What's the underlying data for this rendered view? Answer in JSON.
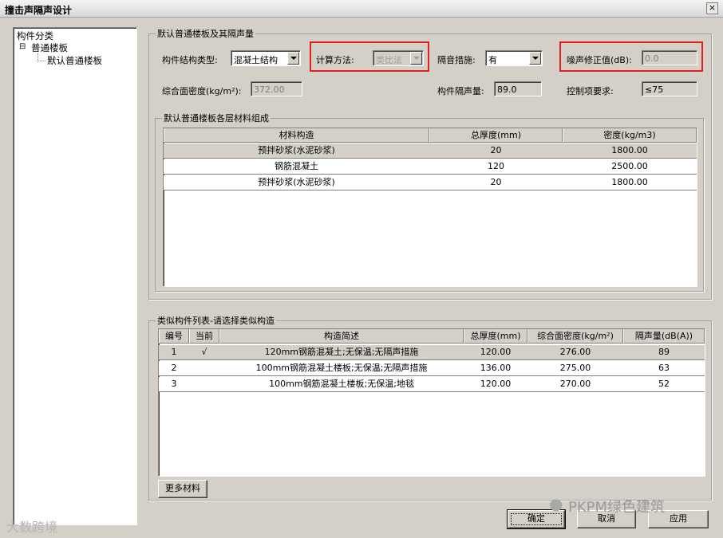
{
  "window": {
    "title": "撞击声隔声设计",
    "close_label": "×"
  },
  "tree": {
    "root": "构件分类",
    "expander": "⊟",
    "node": "普通楼板",
    "leaf": "默认普通楼板"
  },
  "default_group": {
    "caption": "默认普通楼板及其隔声量",
    "structure_type_label": "构件结构类型:",
    "structure_type_value": "混凝土结构",
    "calc_method_label": "计算方法:",
    "calc_method_value": "类比法",
    "measure_label": "隔音措施:",
    "measure_value": "有",
    "noise_correction_label": "噪声修正值(dB):",
    "noise_correction_value": "0.0",
    "density_label": "综合面密度(kg/m²):",
    "density_value": "372.00",
    "insulation_label": "构件隔声量:",
    "insulation_value": "89.0",
    "control_label": "控制项要求:",
    "control_value": "≤75"
  },
  "layers_group": {
    "caption": "默认普通楼板各层材料组成",
    "columns": [
      "材料构造",
      "总厚度(mm)",
      "密度(kg/m3)"
    ],
    "rows": [
      [
        "预拌砂浆(水泥砂浆)",
        "20",
        "1800.00"
      ],
      [
        "钢筋混凝土",
        "120",
        "2500.00"
      ],
      [
        "预拌砂浆(水泥砂浆)",
        "20",
        "1800.00"
      ]
    ]
  },
  "similar_group": {
    "caption": "类似构件列表-请选择类似构造",
    "columns": [
      "编号",
      "当前",
      "构造简述",
      "总厚度(mm)",
      "综合面密度(kg/m²)",
      "隔声量(dB(A))"
    ],
    "rows": [
      [
        "1",
        "√",
        "120mm钢筋混凝土;无保温;无隔声措施",
        "120.00",
        "276.00",
        "89"
      ],
      [
        "2",
        "",
        "100mm钢筋混凝土楼板;无保温;无隔声措施",
        "136.00",
        "275.00",
        "63"
      ],
      [
        "3",
        "",
        "100mm钢筋混凝土楼板;无保温;地毯",
        "120.00",
        "270.00",
        "52"
      ]
    ],
    "more_button": "更多材料"
  },
  "buttons": {
    "ok": "确定",
    "cancel": "取消",
    "apply": "应用"
  },
  "watermarks": {
    "right": "PKPM绿色建筑",
    "left": "大数跨境"
  },
  "colors": {
    "highlight_border": "#e02020",
    "dialog_bg": "#d4d0c8"
  }
}
